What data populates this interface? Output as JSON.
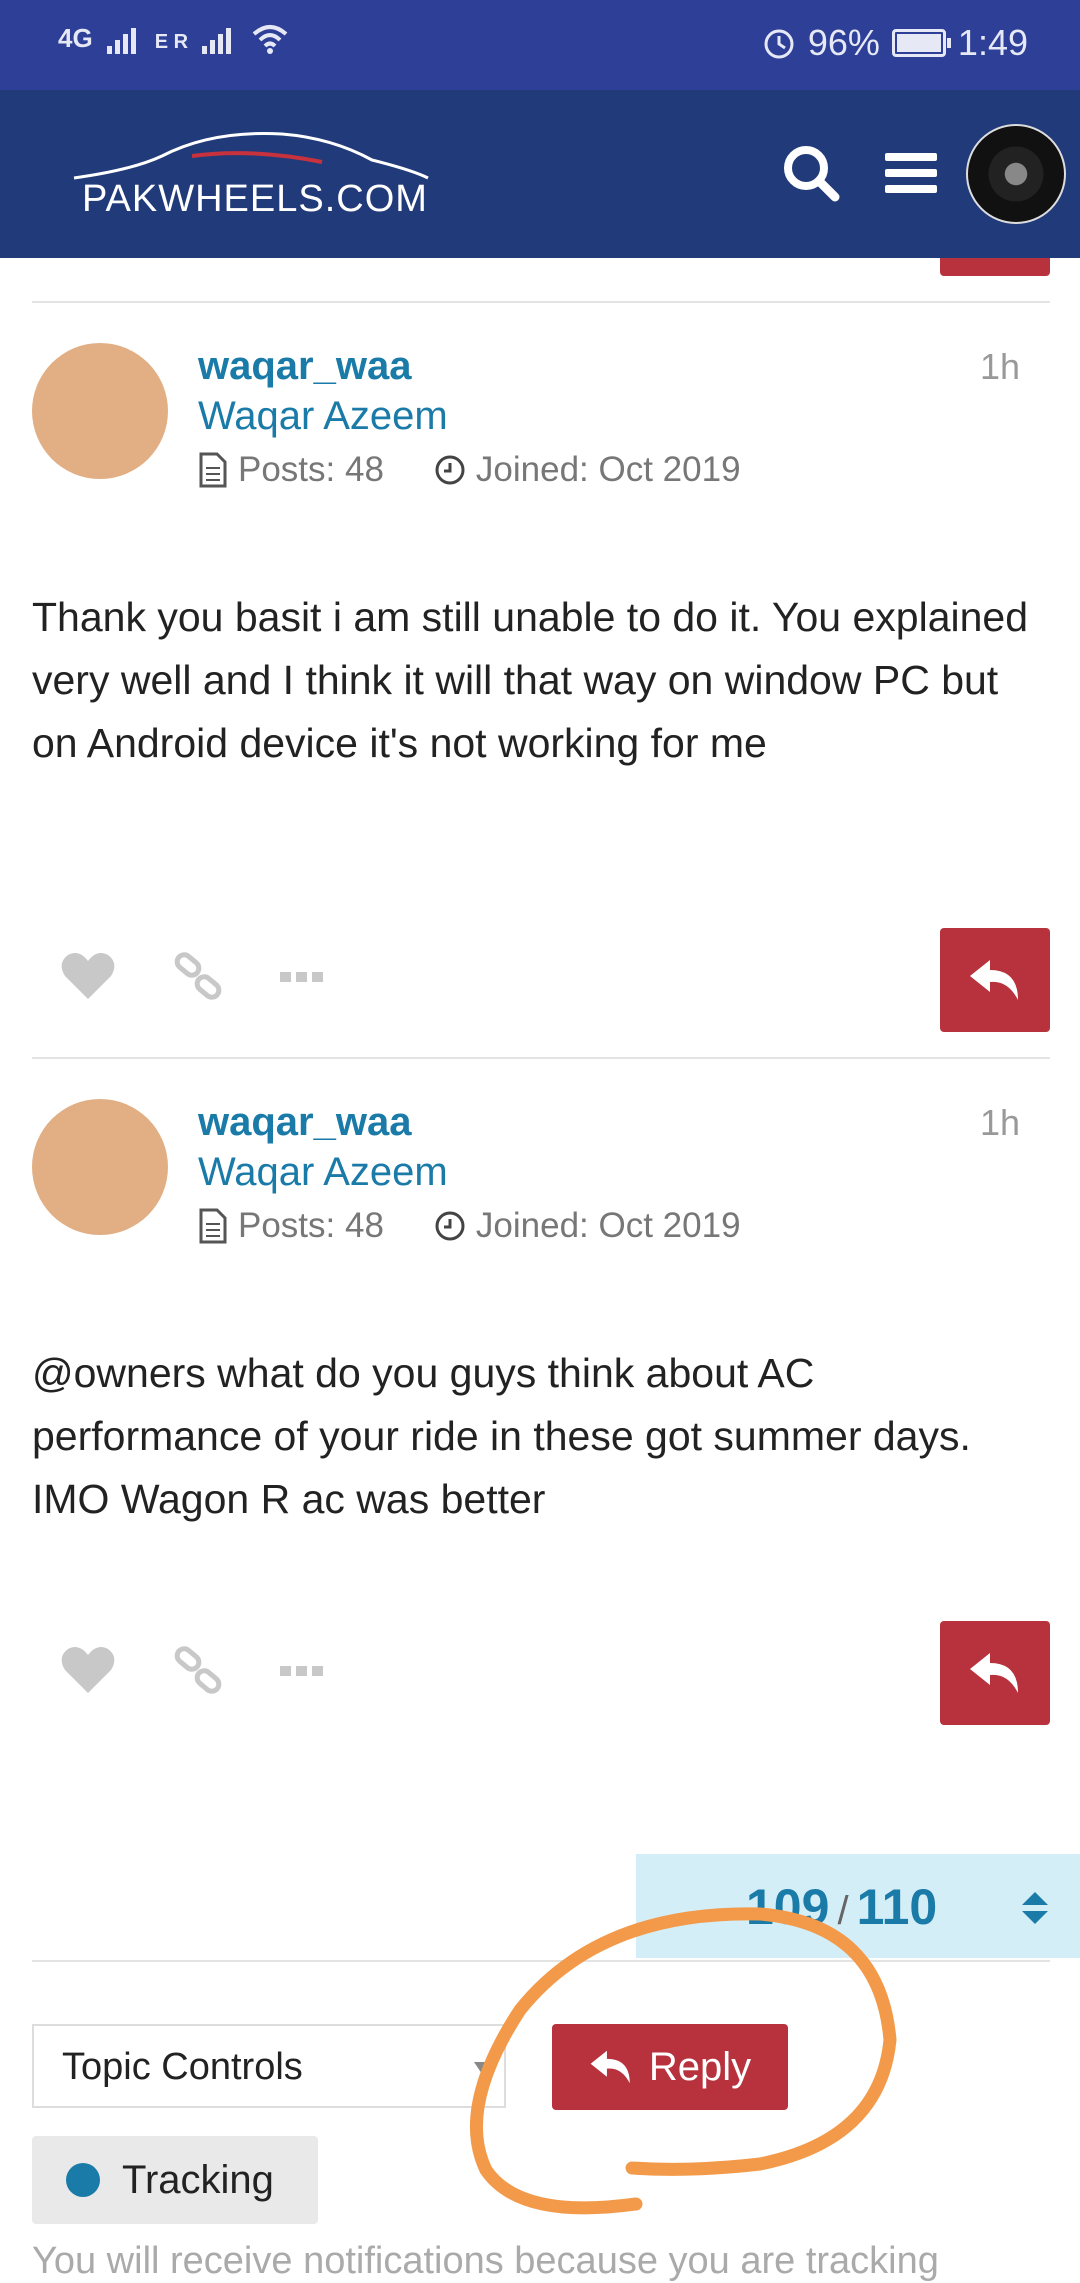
{
  "status_bar": {
    "network_1": "4G",
    "network_2": "E R",
    "battery_percent": "96%",
    "time": "1:49",
    "battery_level": 0.96
  },
  "header": {
    "logo_text": "PAKWHEELS.COM",
    "search_icon": "search-icon",
    "menu_icon": "hamburger-menu-icon"
  },
  "posts": [
    {
      "username": "waqar_waa",
      "full_name": "Waqar Azeem",
      "posts_label": "Posts: 48",
      "joined_label": "Joined: Oct 2019",
      "time": "1h",
      "body": "Thank you basit i am still unable to do it. You explained very well and I think it will that way on window PC but on Android device it's not working for me"
    },
    {
      "username": "waqar_waa",
      "full_name": "Waqar Azeem",
      "posts_label": "Posts: 48",
      "joined_label": "Joined: Oct 2019",
      "time": "1h",
      "body": "@owners what do you guys think about AC performance of your ride in these got summer days. IMO Wagon R ac was better"
    }
  ],
  "progress": {
    "current": "109",
    "separator": "/",
    "total": "110"
  },
  "footer": {
    "topic_controls_label": "Topic Controls",
    "reply_label": "Reply",
    "tracking_label": "Tracking",
    "notification_text": "You will receive notifications because you are tracking"
  },
  "colors": {
    "status_bar": "#2d3f96",
    "header": "#213a7a",
    "link": "#1a7aa8",
    "reply_red": "#b8323d",
    "avatar": "#e2af84",
    "annotation_orange": "#f39a4a"
  }
}
